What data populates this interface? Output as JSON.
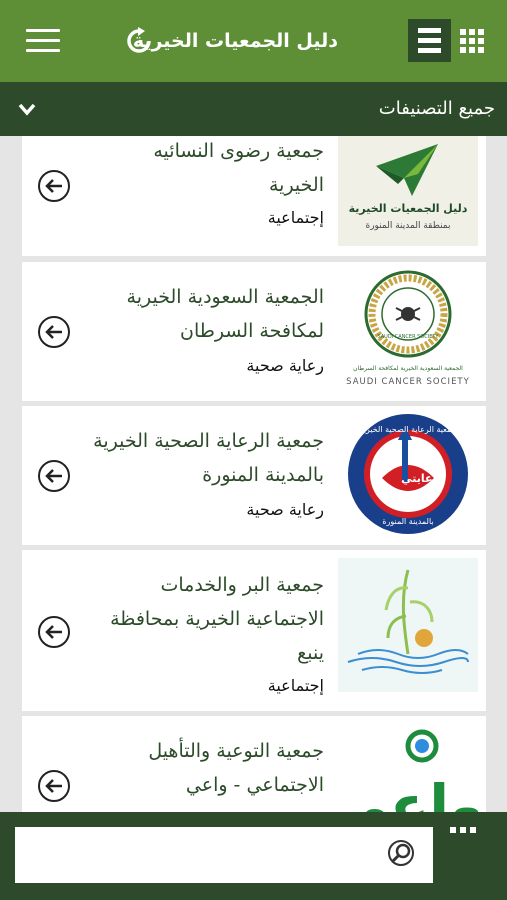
{
  "header": {
    "title": "دليل الجمعيات الخيرية",
    "menu_icon": "hamburger-icon",
    "refresh_icon": "refresh-icon",
    "list_view_icon": "list-view-icon",
    "grid_view_icon": "grid-view-icon"
  },
  "filter": {
    "label": "جميع التصنيفات",
    "icon": "chevron-down-icon"
  },
  "items": [
    {
      "name_lines": [
        "جمعية رضوى النسائيه",
        "الخيرية"
      ],
      "category": "إجتماعية",
      "logo": {
        "title": "دليل الجمعيات الخيرية",
        "subtitle": "بمنطقة المدينة المنورة"
      }
    },
    {
      "name_lines": [
        "الجمعية السعودية الخيرية",
        "لمكافحة السرطان"
      ],
      "category": "رعاية صحية",
      "logo": {
        "ring_text": "SAUDI CANCER SOCIETY",
        "arabic_caption": "الجمعية السعودية الخيرية لمكافحة السرطان",
        "english_caption": "SAUDI CANCER SOCIETY"
      }
    },
    {
      "name_lines": [
        "جمعية الرعاية الصحية الخيرية",
        "بالمدينة المنورة"
      ],
      "category": "رعاية صحية",
      "logo": {
        "top_text": "جمعية الرعاية الصحية الخيرية",
        "center_text": "رعايتي",
        "bottom_text": "بالمدينة المنورة"
      }
    },
    {
      "name_lines": [
        "جمعية البر والخدمات",
        "الاجتماعية الخيرية بمحافظة",
        "ينبع"
      ],
      "category": "إجتماعية",
      "logo": {}
    },
    {
      "name_lines": [
        "جمعية التوعية والتأهيل",
        "الاجتماعي - واعي"
      ],
      "category": "",
      "logo": {
        "brand_text": "واعي"
      }
    }
  ],
  "search": {
    "placeholder": "",
    "value": "",
    "icon": "search-icon"
  },
  "more_icon": "more-options-icon",
  "colors": {
    "primary_green": "#5e8f36",
    "dark_green": "#2d4b2a",
    "background": "#e5e5e5",
    "logo_red": "#d21f26",
    "logo_blue": "#1a4fa0"
  }
}
